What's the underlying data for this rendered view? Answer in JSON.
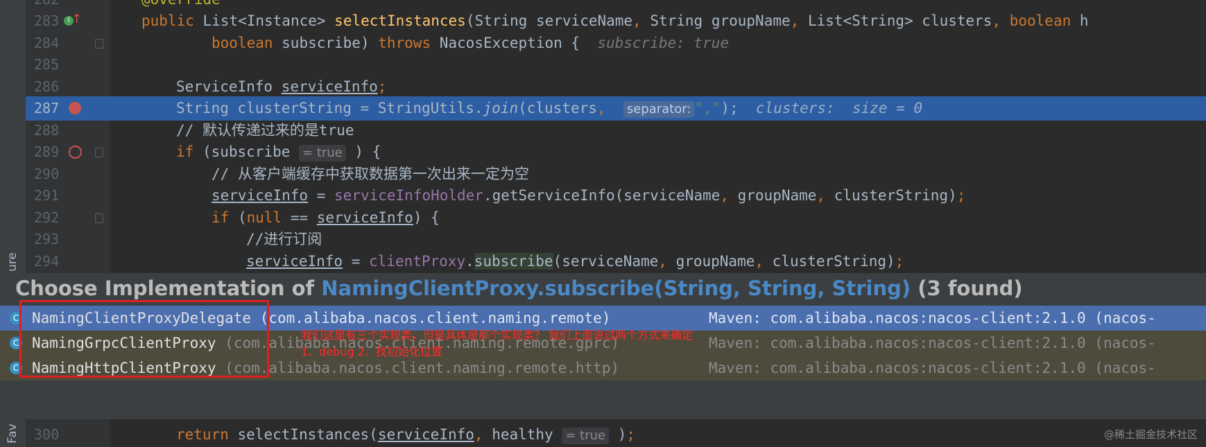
{
  "side_labels": {
    "structure": "ure",
    "favorites": "Fav"
  },
  "code_lines": [
    {
      "no": "282",
      "text": "@Override"
    },
    {
      "no": "283",
      "text": "public List<Instance> selectInstances(String serviceName, String groupName, List<String> clusters, boolean h"
    },
    {
      "no": "284",
      "text": "boolean subscribe) throws NacosException {",
      "hint": "subscribe: true"
    },
    {
      "no": "285",
      "text": ""
    },
    {
      "no": "286",
      "text": "ServiceInfo serviceInfo;"
    },
    {
      "no": "287",
      "text": "String clusterString = StringUtils.join(clusters,",
      "inlay": "separator:",
      "text2": "\",\");",
      "hint": "clusters:  size = 0"
    },
    {
      "no": "288",
      "text": "// 默认传递过来的是true"
    },
    {
      "no": "289",
      "text": "if (subscribe",
      "inlay": "= true",
      "text2": ") {"
    },
    {
      "no": "290",
      "text": "// 从客户端缓存中获取数据第一次出来一定为空"
    },
    {
      "no": "291",
      "text": "serviceInfo = serviceInfoHolder.getServiceInfo(serviceName, groupName, clusterString);"
    },
    {
      "no": "292",
      "text": "if (null == serviceInfo) {"
    },
    {
      "no": "293",
      "text": "//进行订阅"
    },
    {
      "no": "294",
      "text": "serviceInfo = clientProxy.subscribe(serviceName, groupName, clusterString);"
    },
    {
      "no": "300",
      "text": "return selectInstances(serviceInfo, healthy",
      "inlay": "= true",
      "text2": ");"
    }
  ],
  "popup": {
    "title_prefix": "Choose Implementation of",
    "title_method": "NamingClientProxy.subscribe(String, String, String)",
    "title_suffix": "(3 found)",
    "items": [
      {
        "name": "NamingClientProxyDelegate",
        "package": "(com.alibaba.nacos.client.naming.remote)",
        "maven": "Maven: com.alibaba.nacos:nacos-client:2.1.0 (nacos-"
      },
      {
        "name": "NamingGrpcClientProxy",
        "package": "(com.alibaba.nacos.client.naming.remote.gprc)",
        "maven": "Maven: com.alibaba.nacos:nacos-client:2.1.0 (nacos-"
      },
      {
        "name": "NamingHttpClientProxy",
        "package": "(com.alibaba.nacos.client.naming.remote.http)",
        "maven": "Maven: com.alibaba.nacos:nacos-client:2.1.0 (nacos-"
      }
    ]
  },
  "annotations": {
    "line1": "我们这里有三个实现类，但是具体是那个实现类？ 我们上面说过两个方式来确定",
    "line2": "1、debug 2、找初始化位置"
  },
  "watermark": "@稀土掘金技术社区",
  "colors": {
    "selection": "#4b6eaf",
    "current_line": "#2d5ea3",
    "annotation": "#e02020",
    "link": "#4a88c7"
  }
}
